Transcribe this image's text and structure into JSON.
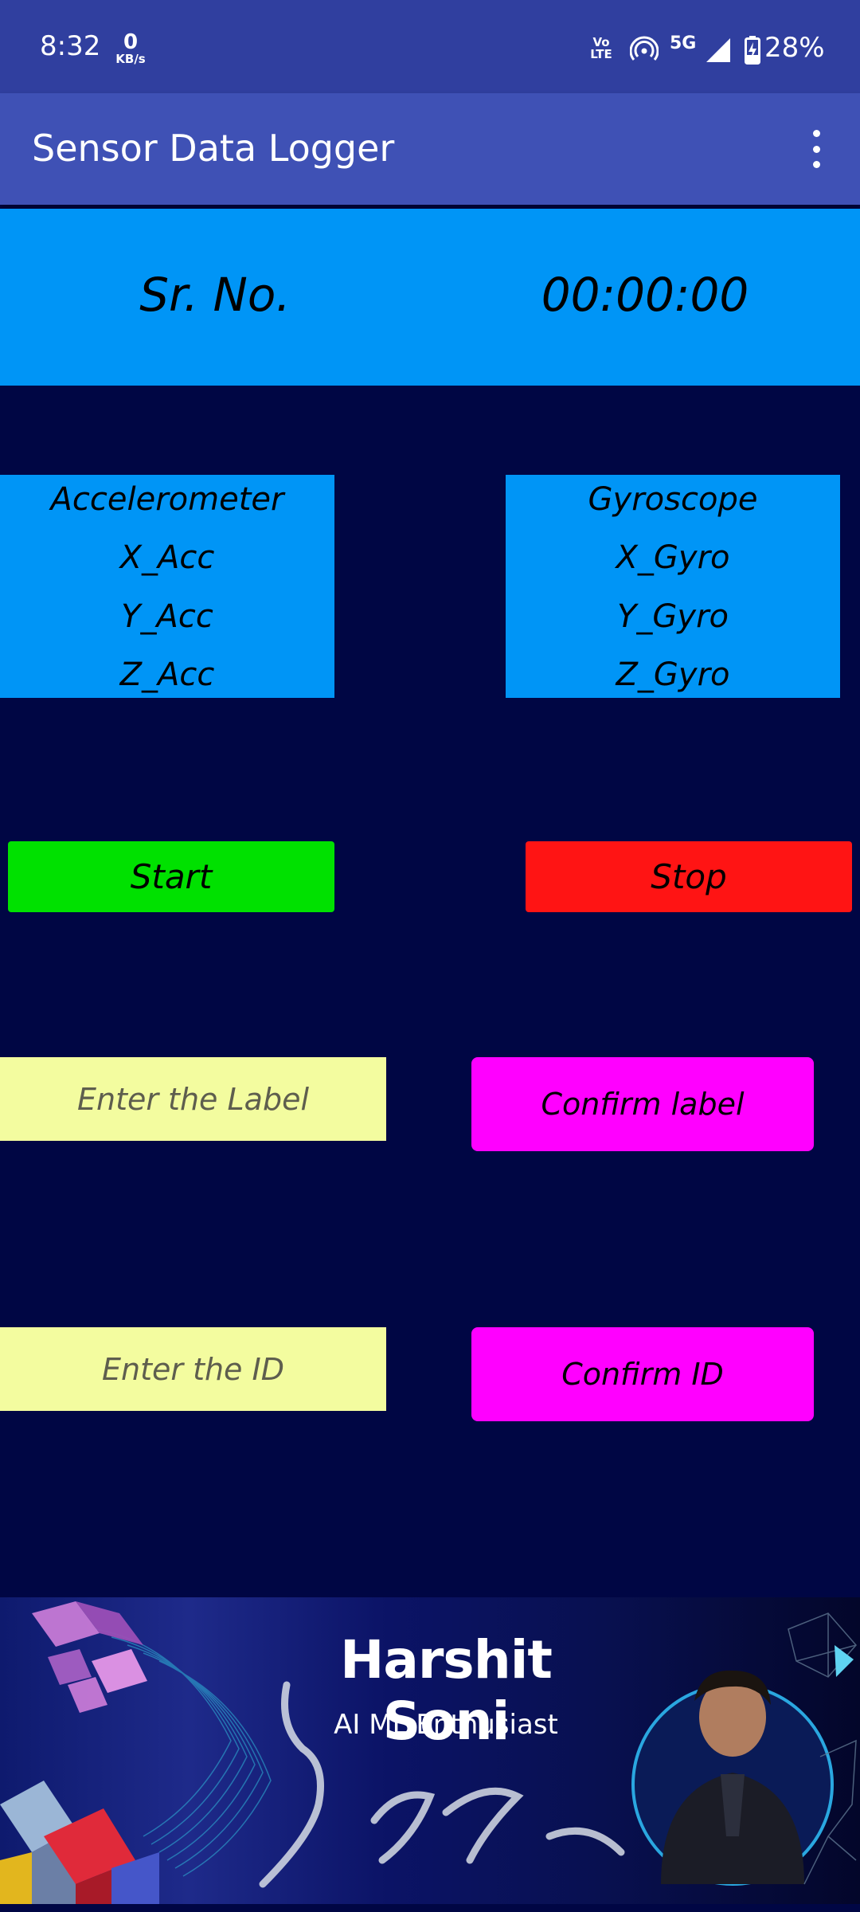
{
  "status_bar": {
    "time": "8:32",
    "net_speed_value": "0",
    "net_speed_unit": "KB/s",
    "volte_label": "Vo LTE",
    "network_type": "5G",
    "battery_percent": "28%",
    "icons": [
      "volte-icon",
      "hotspot-icon",
      "5g-icon",
      "signal-icon",
      "battery-charging-icon"
    ]
  },
  "app_bar": {
    "title": "Sensor Data Logger",
    "menu_icon": "overflow-menu-icon"
  },
  "header": {
    "serial_label": "Sr. No.",
    "timer": "00:00:00"
  },
  "accelerometer": {
    "title": "Accelerometer",
    "x": "X_Acc",
    "y": "Y_Acc",
    "z": "Z_Acc"
  },
  "gyroscope": {
    "title": "Gyroscope",
    "x": "X_Gyro",
    "y": "Y_Gyro",
    "z": "Z_Gyro"
  },
  "controls": {
    "start_label": "Start",
    "stop_label": "Stop"
  },
  "label_form": {
    "placeholder": "Enter the Label",
    "confirm_label": "Confirm label"
  },
  "id_form": {
    "placeholder": "Enter the ID",
    "confirm_label": "Confirm ID"
  },
  "banner": {
    "name": "Harshit Soni",
    "subtitle": "AI ML Enthusiast"
  },
  "colors": {
    "status_bar": "#303F9F",
    "app_bar": "#3F51B5",
    "background": "#000644",
    "panel_blue": "#0095F6",
    "start_green": "#00E100",
    "stop_red": "#FF1414",
    "input_yellow": "#F3FC9F",
    "confirm_magenta": "#FF00FF"
  }
}
